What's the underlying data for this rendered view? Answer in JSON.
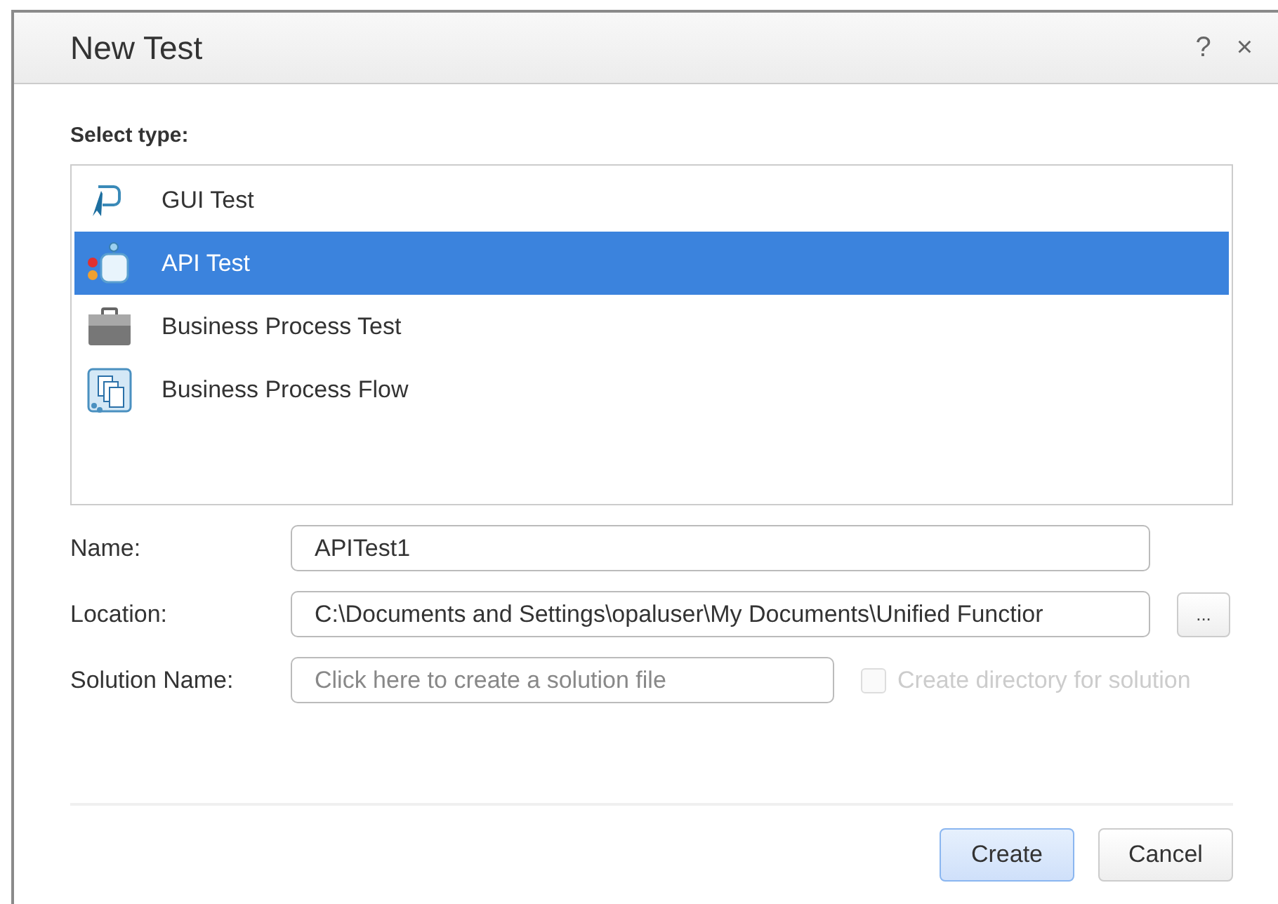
{
  "window": {
    "title": "New Test",
    "help": "?",
    "close": "×"
  },
  "type_list": {
    "label": "Select type:",
    "items": [
      {
        "label": "GUI Test",
        "kind": "gui",
        "selected": false
      },
      {
        "label": "API Test",
        "kind": "api",
        "selected": true
      },
      {
        "label": "Business Process Test",
        "kind": "briefcase",
        "selected": false
      },
      {
        "label": "Business Process Flow",
        "kind": "flow",
        "selected": false
      }
    ]
  },
  "name": {
    "label": "Name:",
    "value": "APITest1"
  },
  "location": {
    "label": "Location:",
    "value": "C:\\Documents and Settings\\opaluser\\My Documents\\Unified Functior",
    "browse": "..."
  },
  "solution": {
    "label": "Solution Name:",
    "placeholder": "Click here to create a solution file",
    "checkbox": {
      "label": "Create directory for solution",
      "checked": false,
      "disabled": true
    }
  },
  "buttons": [
    {
      "label": "Create",
      "default": true
    },
    {
      "label": "Cancel",
      "default": false
    }
  ]
}
